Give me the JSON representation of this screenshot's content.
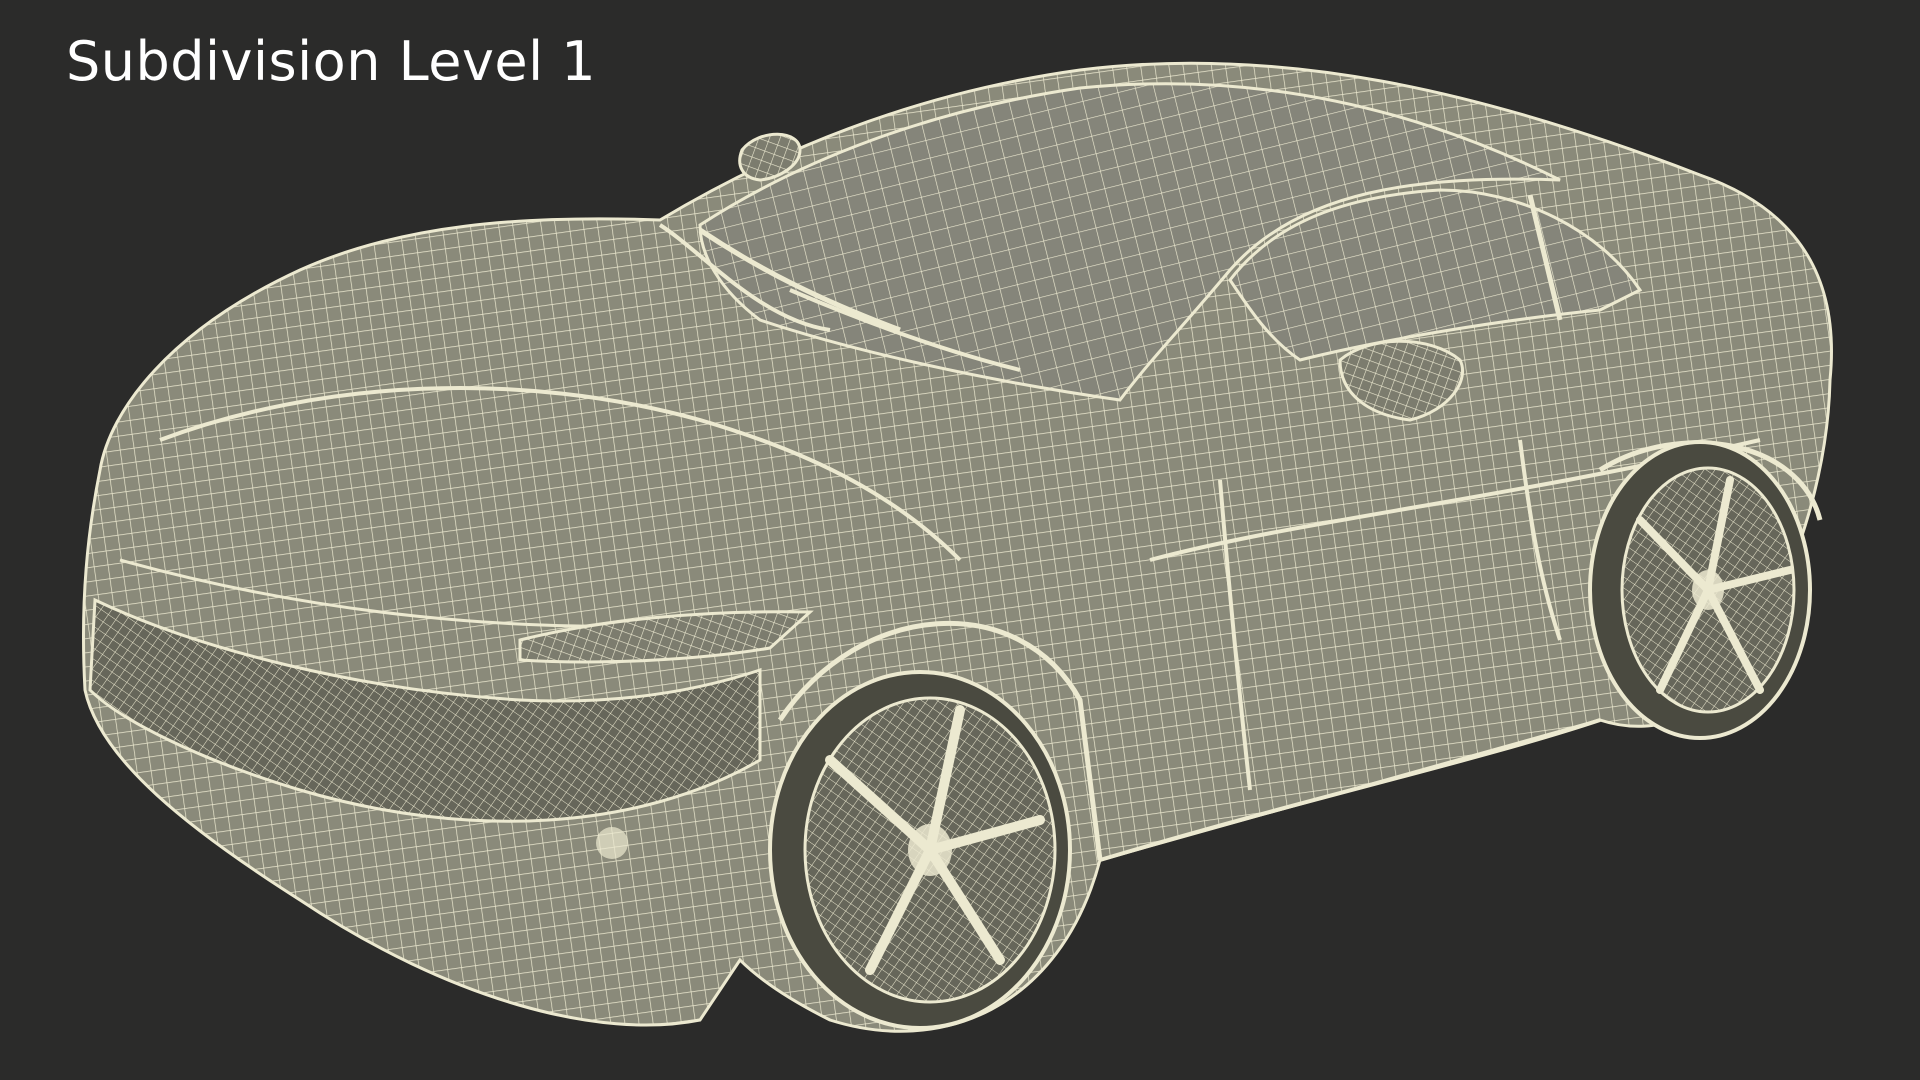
{
  "caption": "Subdivision Level 1",
  "colors": {
    "background": "#2b2b2a",
    "body_fill": "#8c8c7c",
    "wire": "#ece9d0",
    "shadow": "#5f5f54",
    "caption": "#ffffff"
  },
  "subject": "car-wireframe"
}
